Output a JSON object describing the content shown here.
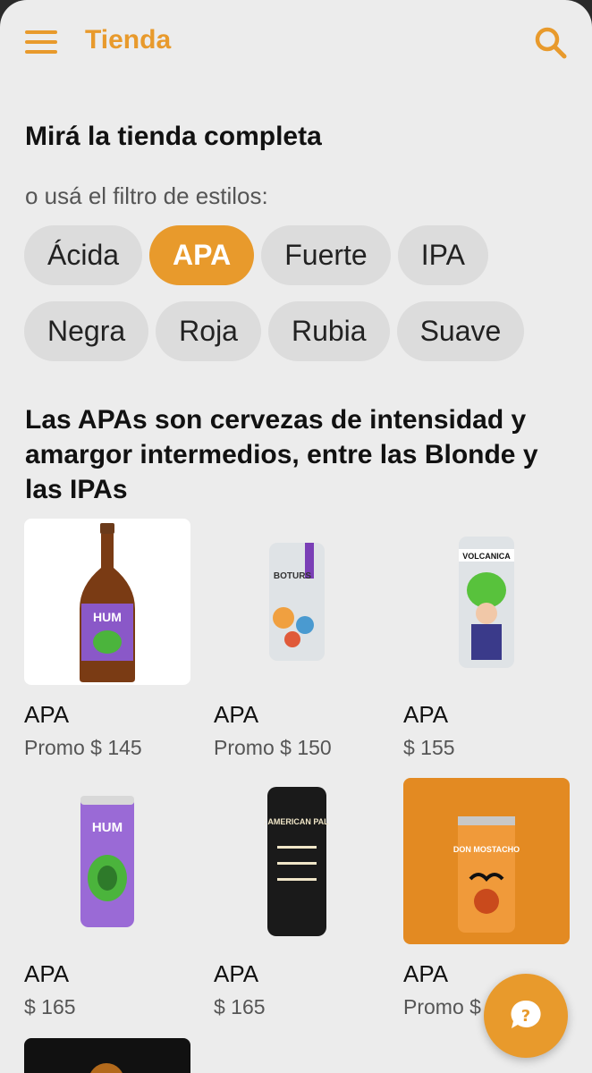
{
  "header": {
    "title": "Tienda",
    "menu_icon": "hamburger-menu-icon",
    "search_icon": "search-icon"
  },
  "heading": "Mirá la tienda completa",
  "filter_hint": "o usá el filtro de estilos:",
  "styles": {
    "row1": [
      {
        "label": "Ácida",
        "active": false
      },
      {
        "label": "APA",
        "active": true
      },
      {
        "label": "Fuerte",
        "active": false
      },
      {
        "label": "IPA",
        "active": false
      }
    ],
    "row2": [
      {
        "label": "Negra",
        "active": false
      },
      {
        "label": "Roja",
        "active": false
      },
      {
        "label": "Rubia",
        "active": false
      },
      {
        "label": "Suave",
        "active": false
      }
    ]
  },
  "description": "Las APAs son cervezas de intensidad y amargor intermedios, entre las Blonde y las IPAs",
  "products": [
    {
      "name": "APA",
      "price": "Promo $ 145",
      "image_text": "HUM"
    },
    {
      "name": "APA",
      "price": "Promo $ 150",
      "image_text": "BOTURS"
    },
    {
      "name": "APA",
      "price": "$ 155",
      "image_text": "VOLCANICA"
    },
    {
      "name": "APA",
      "price": "$ 165",
      "image_text": "HUM"
    },
    {
      "name": "APA",
      "price": "$ 165",
      "image_text": "Davok AMERICAN PALE ALE"
    },
    {
      "name": "APA",
      "price": "Promo $",
      "image_text": "DON MOSTACHO"
    }
  ],
  "colors": {
    "accent": "#e89a2c",
    "chip_bg": "#dcdcdc",
    "background": "#ececec"
  },
  "help_button_icon": "question-chat-icon"
}
